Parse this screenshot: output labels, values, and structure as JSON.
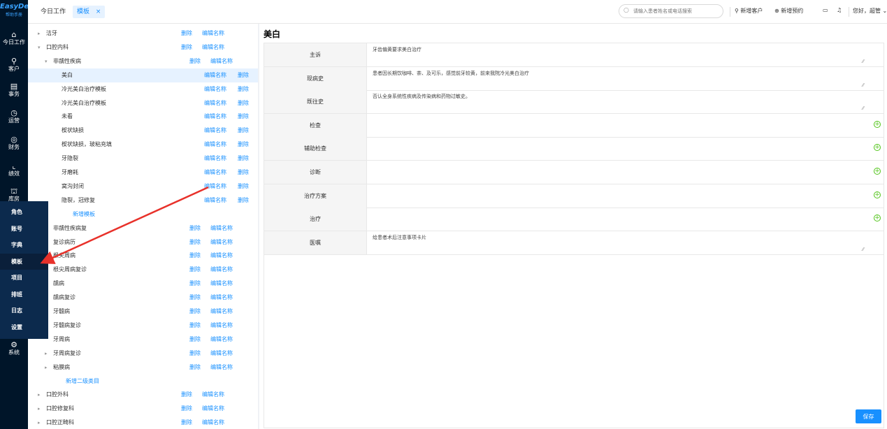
{
  "brand": {
    "logo": "EasyDent",
    "subtitle": "帮助手册"
  },
  "nav": [
    {
      "icon": "⌂",
      "label": "今日工作",
      "name": "home-icon"
    },
    {
      "icon": "⚲",
      "label": "客户",
      "name": "user-icon"
    },
    {
      "icon": "▤",
      "label": "事务",
      "name": "document-icon"
    },
    {
      "icon": "◷",
      "label": "运营",
      "name": "clock-icon"
    },
    {
      "icon": "◎",
      "label": "财务",
      "name": "finance-icon"
    },
    {
      "icon": "⌞",
      "label": "绩效",
      "name": "chart-icon"
    },
    {
      "icon": "⛫",
      "label": "库房",
      "name": "warehouse-icon"
    },
    {
      "icon": "⚙",
      "label": "系统",
      "name": "gear-icon"
    }
  ],
  "flyout": [
    "角色",
    "账号",
    "字典",
    "模板",
    "项目",
    "排班",
    "日志",
    "设置"
  ],
  "header": {
    "tabs": [
      "今日工作",
      "模板"
    ],
    "close": "×",
    "search_placeholder": "请输入患者姓名或电话搜索",
    "new_customer": "新增客户",
    "new_appointment": "新增预约",
    "greeting": "您好，超管"
  },
  "tree": {
    "delete": "删除",
    "edit": "编辑名称",
    "rows": [
      {
        "label": "洁牙",
        "level": 0,
        "arrow": "▸"
      },
      {
        "label": "口腔内科",
        "level": 0,
        "arrow": "▾"
      },
      {
        "label": "非龋性疾病",
        "level": 1,
        "arrow": "▾"
      },
      {
        "label": "美白",
        "level": 2,
        "selected": true
      },
      {
        "label": "冷光美白治疗模板",
        "level": 2
      },
      {
        "label": "冷光美白治疗模板",
        "level": 2
      },
      {
        "label": "未看",
        "level": 2
      },
      {
        "label": "楔状缺损",
        "level": 2
      },
      {
        "label": "楔状缺损，玻粘充填",
        "level": 2
      },
      {
        "label": "牙隐裂",
        "level": 2
      },
      {
        "label": "牙磨耗",
        "level": 2
      },
      {
        "label": "窝沟封闭",
        "level": 2
      },
      {
        "label": "隐裂，冠修复",
        "level": 2
      },
      {
        "label": "新增模板",
        "level": 3,
        "add": true
      },
      {
        "label": "非龋性疾病复",
        "level": 1
      },
      {
        "label": "复诊病历",
        "level": 1
      },
      {
        "label": "根尖周病",
        "level": 1
      },
      {
        "label": "根尖周病复诊",
        "level": 1
      },
      {
        "label": "龋病",
        "level": 1
      },
      {
        "label": "龋病复诊",
        "level": 1
      },
      {
        "label": "牙髓病",
        "level": 1
      },
      {
        "label": "牙髓病复诊",
        "level": 1
      },
      {
        "label": "牙周病",
        "level": 1
      },
      {
        "label": "牙周病复诊",
        "level": 1,
        "arrow": "▸"
      },
      {
        "label": "粘膜病",
        "level": 1,
        "arrow": "▸"
      },
      {
        "label": "新增二级类目",
        "level": 4,
        "add": true
      },
      {
        "label": "口腔外科",
        "level": 0,
        "arrow": "▸"
      },
      {
        "label": "口腔修复科",
        "level": 0,
        "arrow": "▸"
      },
      {
        "label": "口腔正畸科",
        "level": 0,
        "arrow": "▸"
      }
    ]
  },
  "form": {
    "title": "美白",
    "save": "保存",
    "fields": [
      {
        "label": "主诉",
        "value": "牙齿偏黄要求美白治疗",
        "type": "text"
      },
      {
        "label": "现病史",
        "value": "患者因长期饮咖啡、茶、及可乐，感觉前牙较黄，前来我院冷光美白治疗",
        "type": "text"
      },
      {
        "label": "既往史",
        "value": "否认全身系统性疾病及传染病和药物过敏史。",
        "type": "text"
      },
      {
        "label": "检查",
        "value": "",
        "type": "add"
      },
      {
        "label": "辅助检查",
        "value": "",
        "type": "add"
      },
      {
        "label": "诊断",
        "value": "",
        "type": "add"
      },
      {
        "label": "治疗方案",
        "value": "",
        "type": "add"
      },
      {
        "label": "治疗",
        "value": "",
        "type": "add"
      },
      {
        "label": "医嘱",
        "value": "给患者术后注意事项卡片",
        "type": "text"
      }
    ]
  },
  "colors": {
    "nav_bg": "#001529",
    "primary": "#1890ff",
    "annotation": "#e8312a",
    "add": "#52c41a"
  }
}
